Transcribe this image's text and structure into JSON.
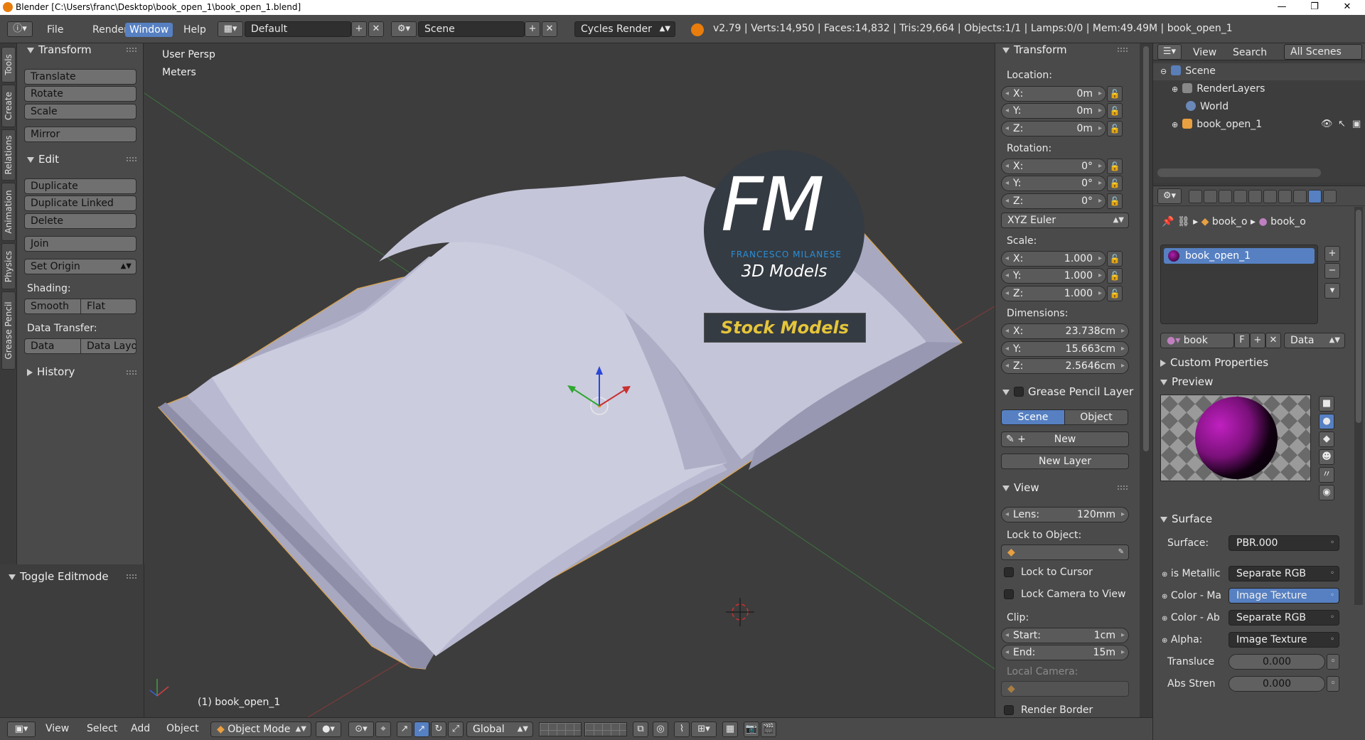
{
  "window": {
    "title": "Blender [C:\\Users\\franc\\Desktop\\book_open_1\\book_open_1.blend]",
    "minimize": "—",
    "maximize": "❐",
    "close": "✕"
  },
  "header": {
    "menus": [
      "File",
      "Render",
      "Window",
      "Help"
    ],
    "active_menu": "Window",
    "layout": "Default",
    "scene": "Scene",
    "engine": "Cycles Render",
    "stats": "v2.79 | Verts:14,950 | Faces:14,832 | Tris:29,664 | Objects:1/1 | Lamps:0/0 | Mem:49.49M | book_open_1"
  },
  "tabs": [
    "Tools",
    "Create",
    "Relations",
    "Animation",
    "Physics",
    "Grease Pencil"
  ],
  "toolshelf": {
    "transform_title": "Transform",
    "translate": "Translate",
    "rotate": "Rotate",
    "scale": "Scale",
    "mirror": "Mirror",
    "edit_title": "Edit",
    "duplicate": "Duplicate",
    "duplicate_linked": "Duplicate Linked",
    "delete": "Delete",
    "join": "Join",
    "set_origin": "Set Origin",
    "shading_label": "Shading:",
    "smooth": "Smooth",
    "flat": "Flat",
    "data_transfer_label": "Data Transfer:",
    "data": "Data",
    "data_layo": "Data Layo",
    "history_title": "History",
    "toggle_editmode": "Toggle Editmode"
  },
  "viewport": {
    "view_name": "User Persp",
    "units": "Meters",
    "object_label": "(1) book_open_1",
    "watermark_letters": "FM",
    "watermark_name": "FRANCESCO MILANESE",
    "watermark_sub": "3D Models",
    "watermark_banner": "Stock Models"
  },
  "npanel": {
    "transform_title": "Transform",
    "location_label": "Location:",
    "location": [
      {
        "k": "X:",
        "v": "0m"
      },
      {
        "k": "Y:",
        "v": "0m"
      },
      {
        "k": "Z:",
        "v": "0m"
      }
    ],
    "rotation_label": "Rotation:",
    "rotation": [
      {
        "k": "X:",
        "v": "0°"
      },
      {
        "k": "Y:",
        "v": "0°"
      },
      {
        "k": "Z:",
        "v": "0°"
      }
    ],
    "rotation_mode": "XYZ Euler",
    "scale_label": "Scale:",
    "scale": [
      {
        "k": "X:",
        "v": "1.000"
      },
      {
        "k": "Y:",
        "v": "1.000"
      },
      {
        "k": "Z:",
        "v": "1.000"
      }
    ],
    "dimensions_label": "Dimensions:",
    "dimensions": [
      {
        "k": "X:",
        "v": "23.738cm"
      },
      {
        "k": "Y:",
        "v": "15.663cm"
      },
      {
        "k": "Z:",
        "v": "2.5646cm"
      }
    ],
    "gp_title": "Grease Pencil Layer",
    "gp_scene": "Scene",
    "gp_object": "Object",
    "gp_new": "New",
    "gp_new_layer": "New Layer",
    "view_title": "View",
    "lens_label": "Lens:",
    "lens_value": "120mm",
    "lock_to_object": "Lock to Object:",
    "lock_to_cursor": "Lock to Cursor",
    "lock_camera": "Lock Camera to View",
    "clip_label": "Clip:",
    "clip_start_label": "Start:",
    "clip_start": "1cm",
    "clip_end_label": "End:",
    "clip_end": "15m",
    "local_camera": "Local Camera:",
    "render_border": "Render Border"
  },
  "outliner": {
    "view": "View",
    "search": "Search",
    "all_scenes": "All Scenes",
    "items": [
      "Scene",
      "RenderLayers",
      "World",
      "book_open_1"
    ]
  },
  "properties": {
    "breadcrumb_1": "book_o",
    "breadcrumb_2": "book_o",
    "material_slot": "book_open_1",
    "material_name": "book",
    "fake_user": "F",
    "data_link": "Data",
    "custom_props": "Custom Properties",
    "preview": "Preview",
    "surface_title": "Surface",
    "surface_label": "Surface:",
    "surface_value": "PBR.000",
    "inputs": [
      {
        "label": "is Metallic",
        "value": "Separate RGB",
        "highlight": false
      },
      {
        "label": "Color - Ma",
        "value": "Image Texture",
        "highlight": true
      },
      {
        "label": "Color - Ab",
        "value": "Separate RGB",
        "highlight": false
      },
      {
        "label": "Alpha:",
        "value": "Image Texture",
        "highlight": false
      }
    ],
    "translucency_label": "Transluce",
    "translucency_value": "0.000",
    "abs_strength_label": "Abs Stren",
    "abs_strength_value": "0.000"
  },
  "bottombar": {
    "view": "View",
    "select": "Select",
    "add": "Add",
    "object": "Object",
    "mode": "Object Mode",
    "orientation": "Global"
  },
  "colors": {
    "accent": "#5680c2",
    "panel": "#4a4a4a",
    "viewport": "#3d3d3d",
    "book": "#c9c9dc",
    "watermark_blue": "#2a8fd8",
    "watermark_gold": "#e5c53a"
  }
}
